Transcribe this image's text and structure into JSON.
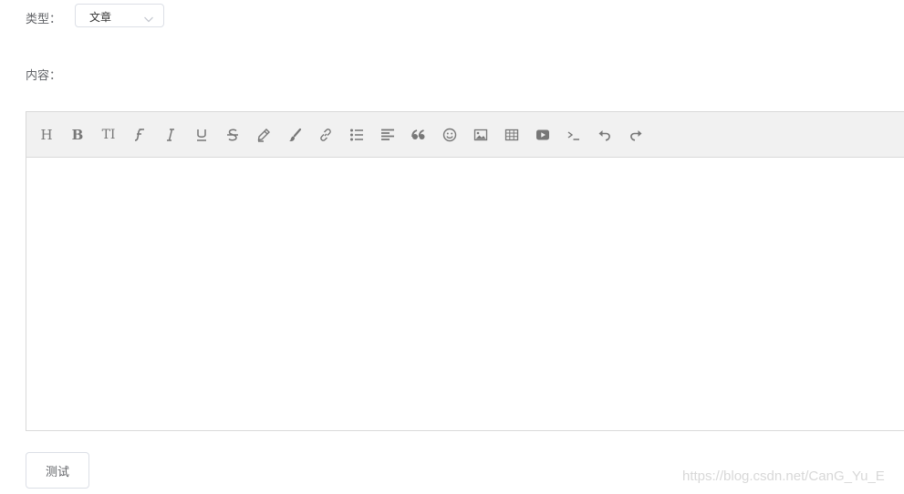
{
  "form": {
    "type_label": "类型：",
    "type_value": "文章",
    "content_label": "内容："
  },
  "toolbar": {
    "heading": "H",
    "bold": "B",
    "font_size": "TI",
    "icons": [
      "heading-icon",
      "bold-icon",
      "font-size-icon",
      "font-family-icon",
      "italic-icon",
      "underline-icon",
      "strikethrough-icon",
      "marker-icon",
      "brush-icon",
      "link-icon",
      "list-icon",
      "align-icon",
      "quote-icon",
      "emoji-icon",
      "image-icon",
      "table-icon",
      "video-icon",
      "code-icon",
      "undo-icon",
      "redo-icon"
    ]
  },
  "actions": {
    "test_label": "测试"
  },
  "watermark": "https://blog.csdn.net/CanG_Yu_E"
}
